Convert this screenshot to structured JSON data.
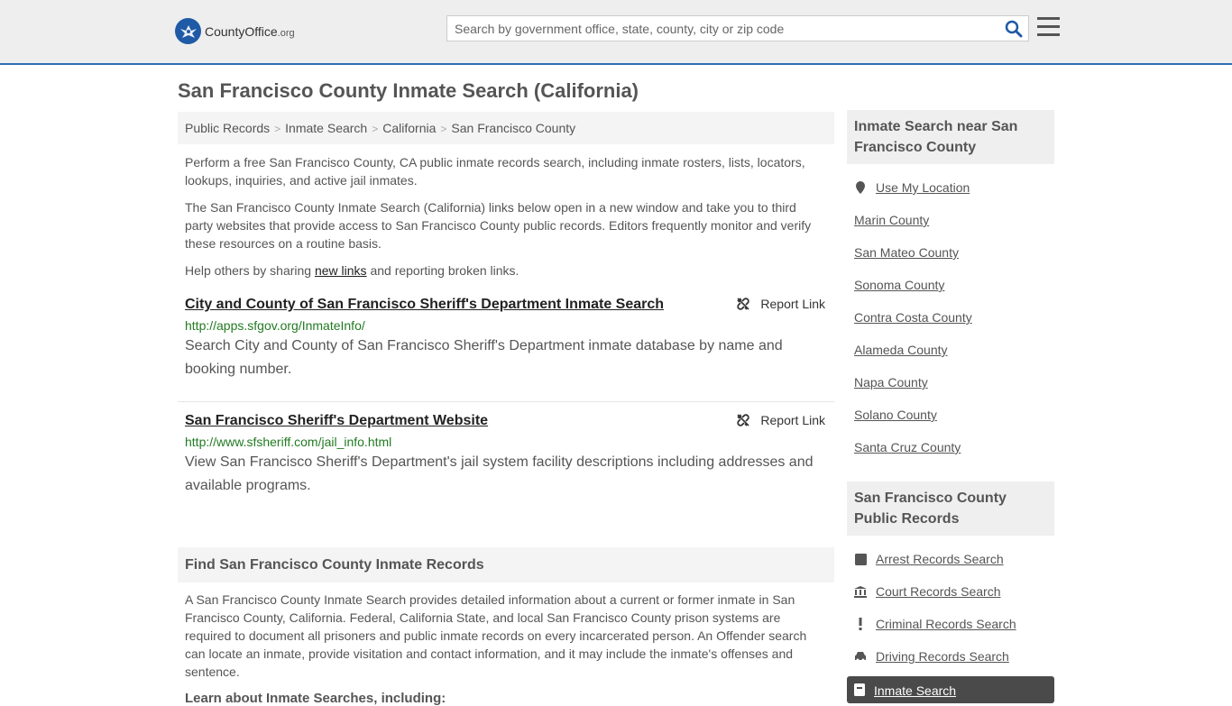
{
  "header": {
    "logo_main": "CountyOffice",
    "logo_tld": ".org",
    "search_placeholder": "Search by government office, state, county, city or zip code"
  },
  "page_title": "San Francisco County Inmate Search (California)",
  "breadcrumb": [
    "Public Records",
    "Inmate Search",
    "California",
    "San Francisco County"
  ],
  "breadcrumb_sep": ">",
  "intro": {
    "p1": "Perform a free San Francisco County, CA public inmate records search, including inmate rosters, lists, locators, lookups, inquiries, and active jail inmates.",
    "p2": "The San Francisco County Inmate Search (California) links below open in a new window and take you to third party websites that provide access to San Francisco County public records. Editors frequently monitor and verify these resources on a routine basis.",
    "p3_pre": "Help others by sharing ",
    "p3_link": "new links",
    "p3_post": " and reporting broken links."
  },
  "results": [
    {
      "title": "City and County of San Francisco Sheriff's Department Inmate Search",
      "url": "http://apps.sfgov.org/InmateInfo/",
      "desc": "Search City and County of San Francisco Sheriff's Department inmate database by name and booking number.",
      "report": "Report Link"
    },
    {
      "title": "San Francisco Sheriff's Department Website",
      "url": "http://www.sfsheriff.com/jail_info.html",
      "desc": "View San Francisco Sheriff's Department's jail system facility descriptions including addresses and available programs.",
      "report": "Report Link"
    }
  ],
  "find_section": {
    "heading": "Find San Francisco County Inmate Records",
    "body": "A San Francisco County Inmate Search provides detailed information about a current or former inmate in San Francisco County, California. Federal, California State, and local San Francisco County prison systems are required to document all prisoners and public inmate records on every incarcerated person. An Offender search can locate an inmate, provide visitation and contact information, and it may include the inmate's offenses and sentence.",
    "learn": "Learn about Inmate Searches, including:"
  },
  "sidebar": {
    "near_heading": "Inmate Search near San Francisco County",
    "near_items": [
      "Use My Location",
      "Marin County",
      "San Mateo County",
      "Sonoma County",
      "Contra Costa County",
      "Alameda County",
      "Napa County",
      "Solano County",
      "Santa Cruz County"
    ],
    "records_heading": "San Francisco County Public Records",
    "records_items": [
      {
        "label": "Arrest Records Search",
        "icon": "square-icon"
      },
      {
        "label": "Court Records Search",
        "icon": "courthouse-icon"
      },
      {
        "label": "Criminal Records Search",
        "icon": "exclamation-icon"
      },
      {
        "label": "Driving Records Search",
        "icon": "car-icon"
      }
    ],
    "active_item": "Inmate Search"
  },
  "colors": {
    "accent_blue": "#2e6eb4",
    "url_green": "#227a22",
    "header_bg": "#eeeeee"
  }
}
